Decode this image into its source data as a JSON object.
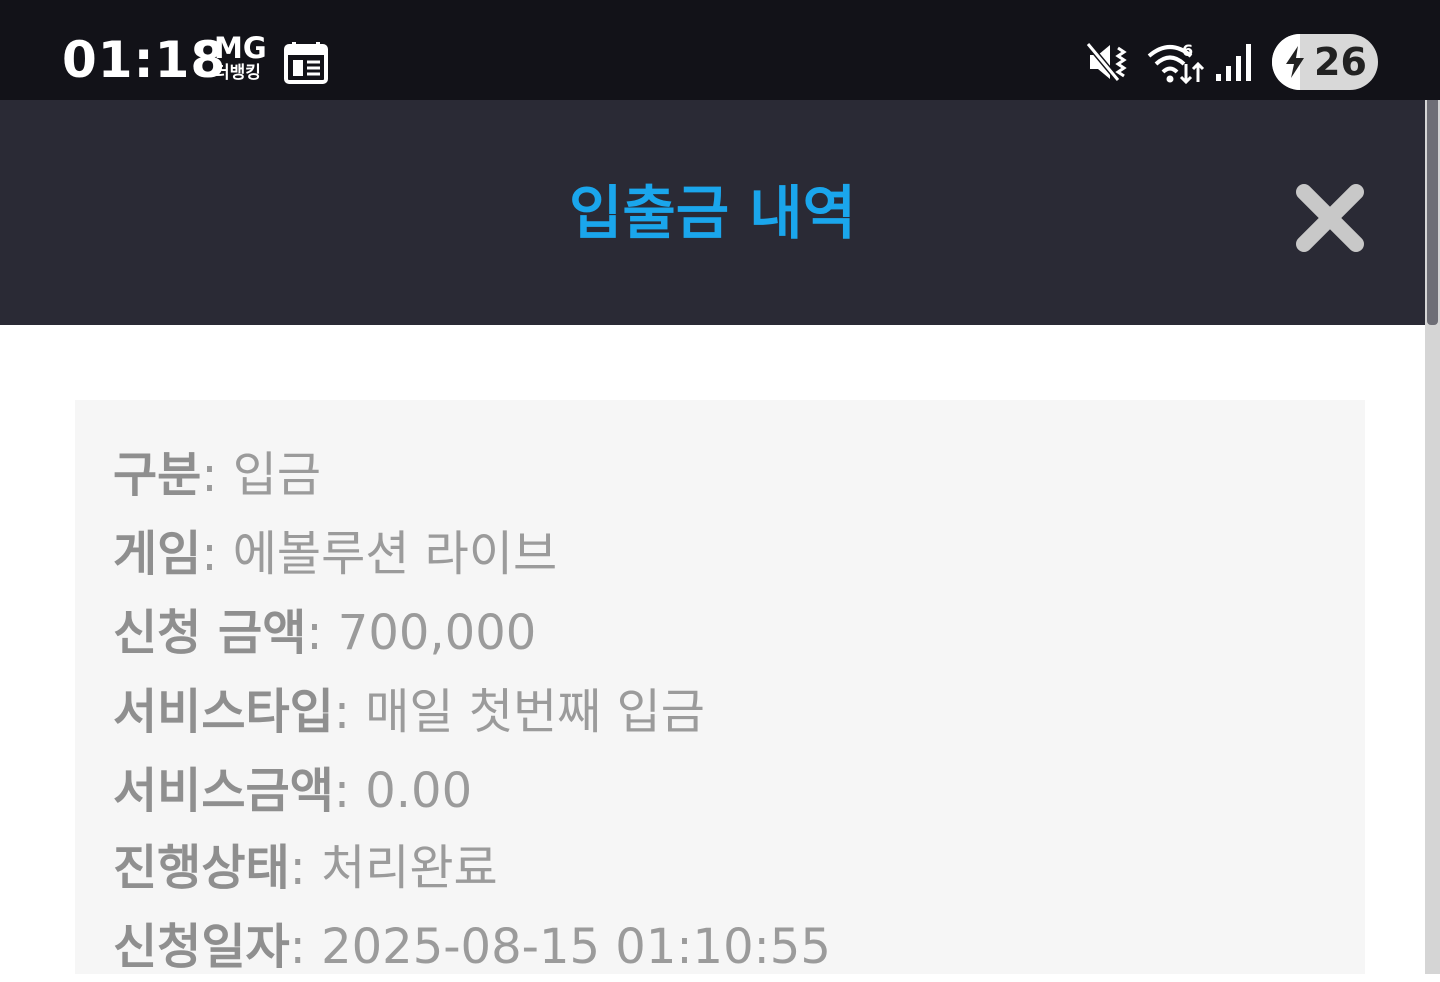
{
  "status_bar": {
    "time": "01:18",
    "carrier_line1": "MG",
    "carrier_line2": "더뱅킹",
    "calendar_icon": "calendar-icon",
    "mute_icon": "vibrate-mute-icon",
    "wifi_icon": "wifi-6-icon",
    "signal_icon": "cell-signal-icon",
    "battery_level": "26",
    "battery_fraction": 0.26
  },
  "modal": {
    "title": "입출금 내역",
    "close_icon": "close-icon"
  },
  "details": [
    {
      "label": "구분",
      "value": "입금"
    },
    {
      "label": "게임",
      "value": "에볼루션 라이브"
    },
    {
      "label": "신청 금액",
      "value": "700,000"
    },
    {
      "label": "서비스타입",
      "value": "매일 첫번째 입금"
    },
    {
      "label": "서비스금액",
      "value": "0.00"
    },
    {
      "label": "진행상태",
      "value": "처리완료"
    },
    {
      "label": "신청일자",
      "value": "2025-08-15 01:10:55"
    }
  ],
  "colors": {
    "title_accent": "#1aa6ec",
    "header_bg": "#2a2a35",
    "status_bg": "#121218",
    "panel_bg": "#f6f6f6",
    "text_gray": "#9b9b9b"
  }
}
